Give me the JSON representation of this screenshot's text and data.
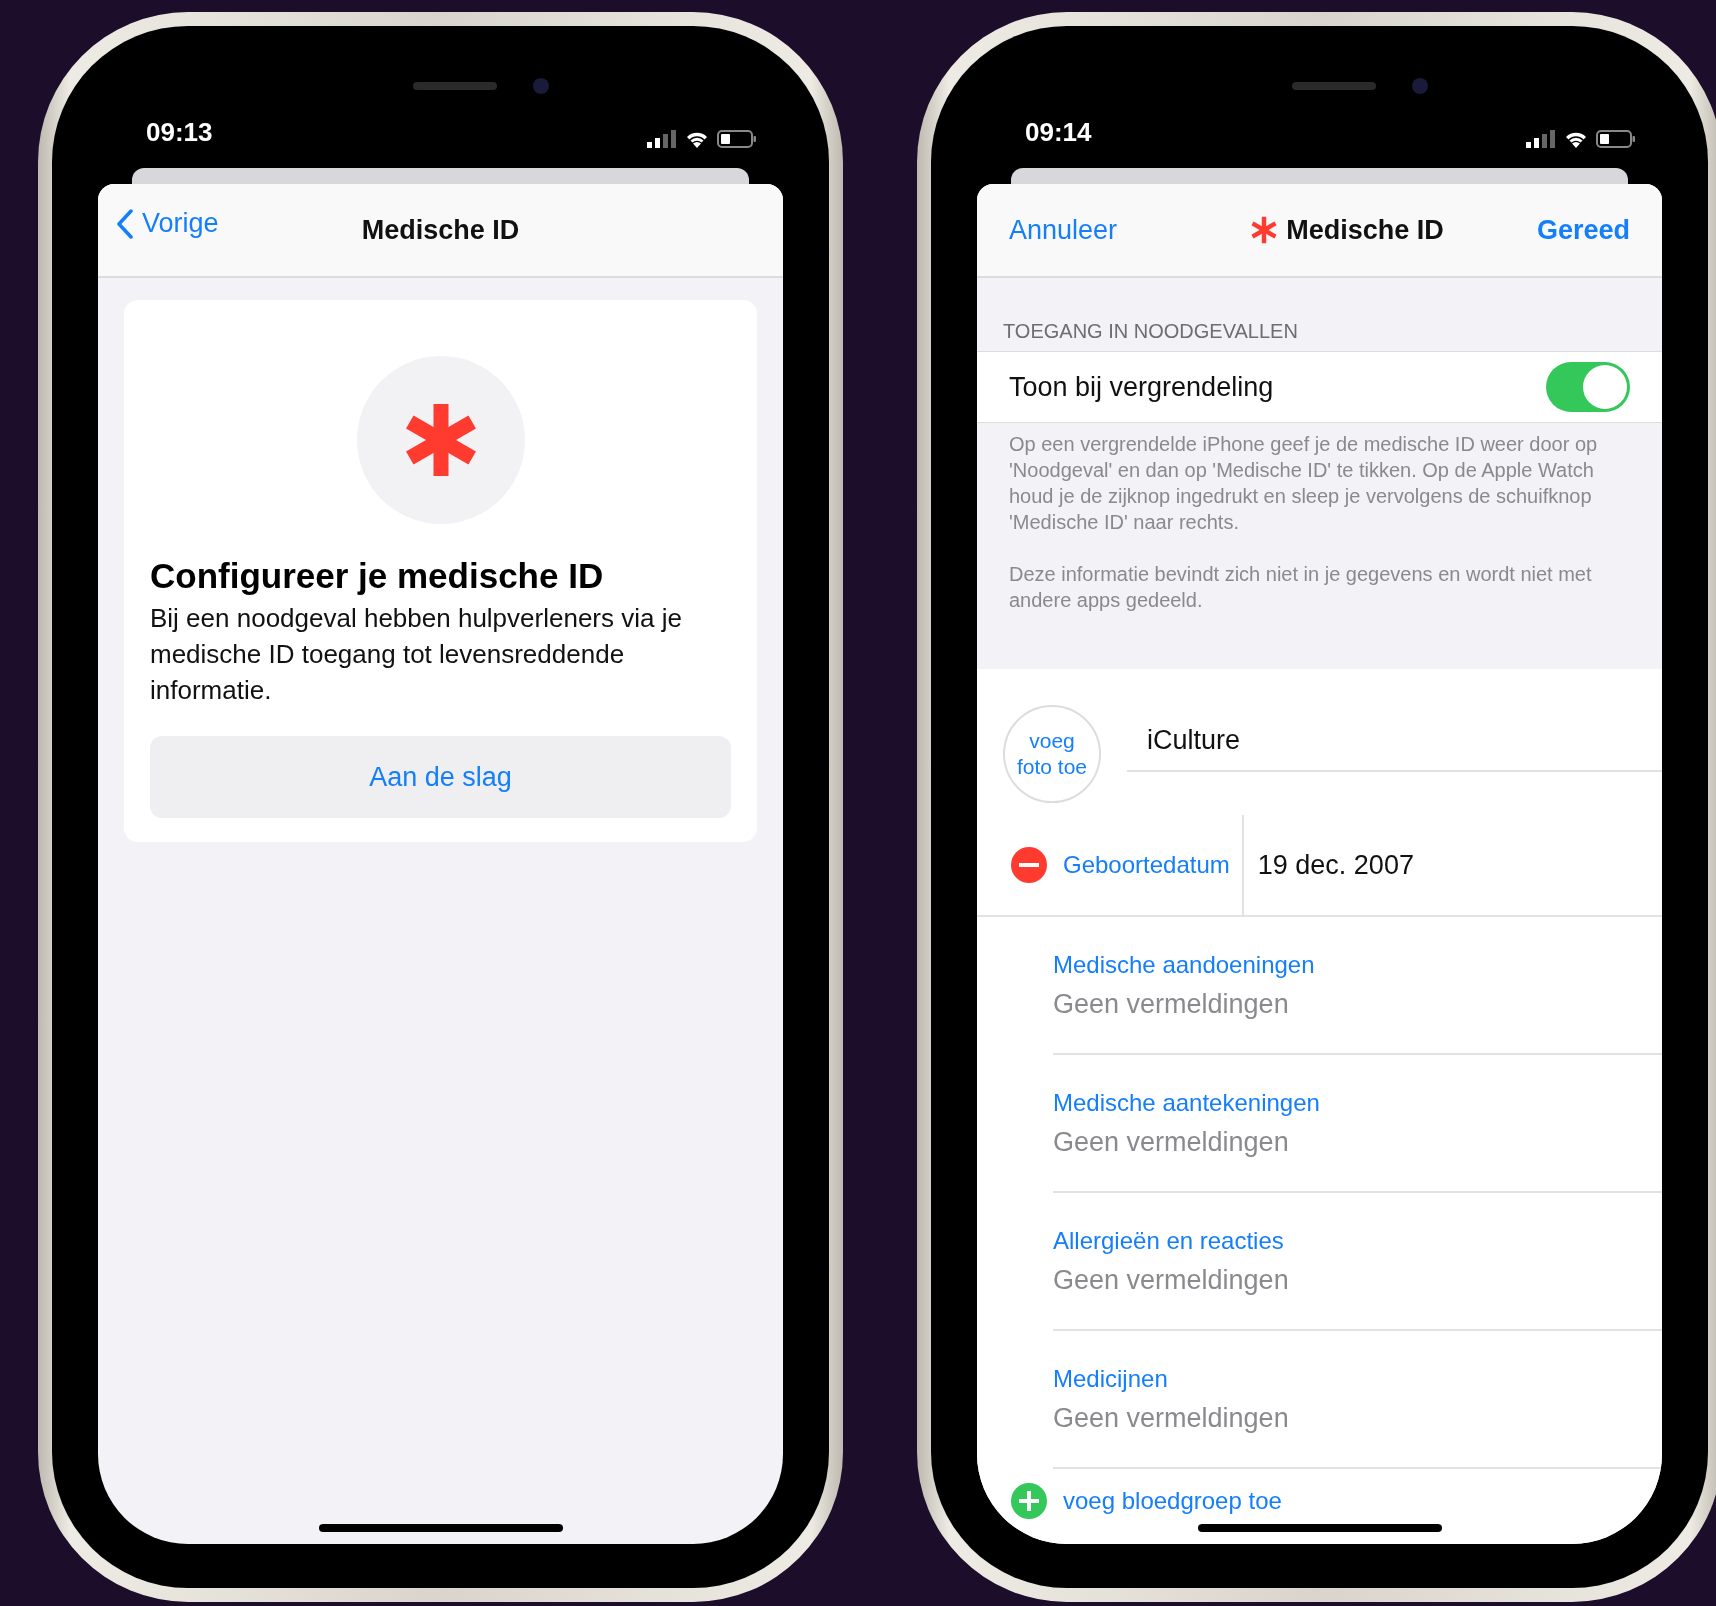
{
  "left_phone": {
    "time": "09:13",
    "nav": {
      "back": "Vorige",
      "title": "Medische ID"
    },
    "card": {
      "heading": "Configureer je medische ID",
      "body": "Bij een noodgeval hebben hulpverleners via je medische ID toegang tot levensreddende informatie.",
      "button": "Aan de slag"
    }
  },
  "right_phone": {
    "time": "09:14",
    "nav": {
      "cancel": "Annuleer",
      "title": "Medische ID",
      "done": "Gereed"
    },
    "section_header": "TOEGANG IN NOODGEVALLEN",
    "toggle": {
      "label": "Toon bij vergrendeling",
      "on": true
    },
    "footer": [
      "Op een vergrendelde iPhone geef je de medische ID weer door op 'Noodgeval' en dan op 'Medische ID' te tikken. Op de Apple Watch houd je de zijknop ingedrukt en sleep je vervolgens de schuifknop 'Medische ID' naar rechts.",
      "Deze informatie bevindt zich niet in je gegevens en wordt niet met andere apps gedeeld."
    ],
    "photo": "voeg foto toe",
    "name": "iCulture",
    "birth": {
      "label": "Geboortedatum",
      "value": "19 dec. 2007"
    },
    "fields": [
      {
        "label": "Medische aandoeningen",
        "value": "Geen vermeldingen"
      },
      {
        "label": "Medische aantekeningen",
        "value": "Geen vermeldingen"
      },
      {
        "label": "Allergieën en reacties",
        "value": "Geen vermeldingen"
      },
      {
        "label": "Medicijnen",
        "value": "Geen vermeldingen"
      }
    ],
    "add_blood": "voeg bloedgroep toe"
  }
}
